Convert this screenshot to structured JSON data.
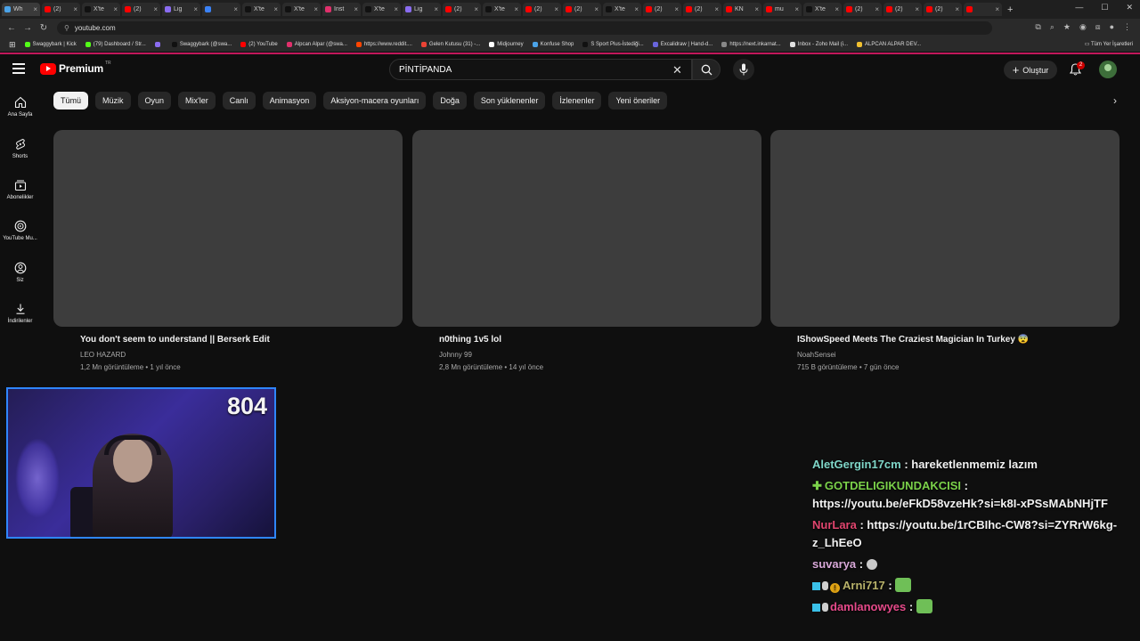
{
  "browser": {
    "tabs": [
      {
        "label": "Wh",
        "color": "#4ba3e8"
      },
      {
        "label": "(2)",
        "color": "#ff0000"
      },
      {
        "label": "X'te",
        "color": "#111111"
      },
      {
        "label": "(2)",
        "color": "#ff0000"
      },
      {
        "label": "Lig",
        "color": "#8a6cf0"
      },
      {
        "label": "",
        "color": "#3b82f6"
      },
      {
        "label": "X'te",
        "color": "#111111"
      },
      {
        "label": "X'te",
        "color": "#111111"
      },
      {
        "label": "İnst",
        "color": "#e1306c"
      },
      {
        "label": "X'te",
        "color": "#111111"
      },
      {
        "label": "Lig",
        "color": "#8a6cf0"
      },
      {
        "label": "(2)",
        "color": "#ff0000"
      },
      {
        "label": "X'te",
        "color": "#111111"
      },
      {
        "label": "(2)",
        "color": "#ff0000"
      },
      {
        "label": "(2)",
        "color": "#ff0000"
      },
      {
        "label": "X'te",
        "color": "#111111"
      },
      {
        "label": "(2)",
        "color": "#ff0000"
      },
      {
        "label": "(2)",
        "color": "#ff0000"
      },
      {
        "label": "KN",
        "color": "#ff0000"
      },
      {
        "label": "mu",
        "color": "#ff0000"
      },
      {
        "label": "X'te",
        "color": "#111111"
      },
      {
        "label": "(2)",
        "color": "#ff0000"
      },
      {
        "label": "(2)",
        "color": "#ff0000"
      },
      {
        "label": "(2)",
        "color": "#ff0000"
      },
      {
        "label": "",
        "color": "#ff0000"
      }
    ],
    "url": "youtube.com",
    "bookmarks": [
      {
        "label": "Swaggybark | Kick",
        "color": "#53fc18"
      },
      {
        "label": "(79) Dashboard / Str...",
        "color": "#53fc18"
      },
      {
        "label": "",
        "color": "#8a6cf0"
      },
      {
        "label": "Swaggybark (@swa...",
        "color": "#111111"
      },
      {
        "label": "(2) YouTube",
        "color": "#ff0000"
      },
      {
        "label": "Alpcan Alpar (@swa...",
        "color": "#e1306c"
      },
      {
        "label": "https://www.reddit....",
        "color": "#ff4500"
      },
      {
        "label": "Gelen Kutusu (31) -...",
        "color": "#ea4335"
      },
      {
        "label": "Midjourney",
        "color": "#ffffff"
      },
      {
        "label": "Konfuse Shop",
        "color": "#4ba3e8"
      },
      {
        "label": "S Sport Plus-İstediği...",
        "color": "#111111"
      },
      {
        "label": "Excalidraw | Hand-d...",
        "color": "#6965db"
      },
      {
        "label": "https://next.inkarnat...",
        "color": "#888888"
      },
      {
        "label": "Inbox - Zoho Mail (i...",
        "color": "#e0e0e0"
      },
      {
        "label": "ALPCAN ALPAR DEV...",
        "color": "#f0c030"
      }
    ],
    "bookmarks_right": "Tüm Yer İşaretleri"
  },
  "header": {
    "logo_text": "Premium",
    "logo_region": "TR",
    "search_value": "PİNTİPANDA",
    "create_label": "Oluştur",
    "notification_count": "2"
  },
  "sidebar": {
    "items": [
      {
        "label": "Ana Sayfa",
        "icon": "home-icon"
      },
      {
        "label": "Shorts",
        "icon": "shorts-icon"
      },
      {
        "label": "Abonelikler",
        "icon": "subscriptions-icon"
      },
      {
        "label": "YouTube Mu...",
        "icon": "youtube-music-icon"
      },
      {
        "label": "Siz",
        "icon": "you-icon"
      },
      {
        "label": "İndirilenler",
        "icon": "download-icon"
      }
    ]
  },
  "chips": [
    "Tümü",
    "Müzik",
    "Oyun",
    "Mix'ler",
    "Canlı",
    "Animasyon",
    "Aksiyon-macera oyunları",
    "Doğa",
    "Son yüklenenler",
    "İzlenenler",
    "Yeni öneriler"
  ],
  "videos": [
    {
      "title": "You don't seem to understand || Berserk Edit",
      "channel": "LEO HAZARD",
      "meta": "1,2 Mn görüntüleme • 1 yıl önce"
    },
    {
      "title": "n0thing 1v5 lol",
      "channel": "Johnny 99",
      "meta": "2,8 Mn görüntüleme • 14 yıl önce"
    },
    {
      "title": "IShowSpeed Meets The Craziest Magician In Turkey 😨",
      "channel": "NoahSensei",
      "meta": "715 B görüntüleme • 7 gün önce"
    }
  ],
  "overlay": {
    "counter": "804"
  },
  "chat": [
    {
      "user": "AletGergin17cm",
      "color": "#7fd6c8",
      "text": "hareketlenmemiz lazım"
    },
    {
      "user": "GOTDELIGIKUNDAKCISI",
      "color": "#7bd14a",
      "text": "https://youtu.be/eFkD58vzeHk?si=k8I-xPSsMAbNHjTF"
    },
    {
      "user": "NurLara",
      "color": "#e0456e",
      "text": "https://youtu.be/1rCBIhc-CW8?si=ZYRrW6kg-z_LhEeO"
    },
    {
      "user": "suvarya",
      "color": "#d8a8d8",
      "text": ""
    },
    {
      "user": "Arni717",
      "color": "#b8b26a",
      "text": ""
    },
    {
      "user": "damlanowyes",
      "color": "#e64a8a",
      "text": ""
    }
  ]
}
